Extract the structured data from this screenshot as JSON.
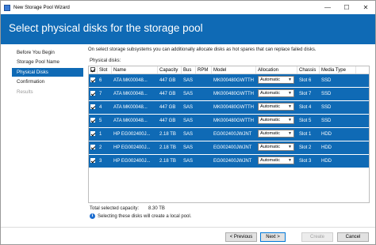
{
  "window": {
    "title": "New Storage Pool Wizard",
    "controls": {
      "minimize": "—",
      "maximize": "☐",
      "close": "✕"
    }
  },
  "header": {
    "title": "Select physical disks for the storage pool"
  },
  "nav": {
    "items": [
      {
        "label": "Before You Begin",
        "state": "normal"
      },
      {
        "label": "Storage Pool Name",
        "state": "normal"
      },
      {
        "label": "Physical Disks",
        "state": "active"
      },
      {
        "label": "Confirmation",
        "state": "normal"
      },
      {
        "label": "Results",
        "state": "disabled"
      }
    ]
  },
  "content": {
    "description": "On select storage subsystems you can additionally allocate disks as hot spares that can replace failed disks.",
    "physical_disks_label": "Physical disks:",
    "columns": [
      "",
      "Slot",
      "Name",
      "Capacity",
      "Bus",
      "RPM",
      "Model",
      "Allocation",
      "Chassis",
      "Media Type"
    ],
    "rows": [
      {
        "checked": true,
        "slot": "6",
        "name": "ATA MK00048...",
        "capacity": "447 GB",
        "bus": "SAS",
        "rpm": "",
        "model": "MK000480GWTTH",
        "allocation": "Automatic",
        "chassis": "Slot 6",
        "media": "SSD"
      },
      {
        "checked": true,
        "slot": "7",
        "name": "ATA MK00048...",
        "capacity": "447 GB",
        "bus": "SAS",
        "rpm": "",
        "model": "MK000480GWTTH",
        "allocation": "Automatic",
        "chassis": "Slot 7",
        "media": "SSD"
      },
      {
        "checked": true,
        "slot": "4",
        "name": "ATA MK00048...",
        "capacity": "447 GB",
        "bus": "SAS",
        "rpm": "",
        "model": "MK000480GWTTH",
        "allocation": "Automatic",
        "chassis": "Slot 4",
        "media": "SSD"
      },
      {
        "checked": true,
        "slot": "5",
        "name": "ATA MK00048...",
        "capacity": "447 GB",
        "bus": "SAS",
        "rpm": "",
        "model": "MK000480GWTTH",
        "allocation": "Automatic",
        "chassis": "Slot 5",
        "media": "SSD"
      },
      {
        "checked": true,
        "slot": "1",
        "name": "HP EG002400J...",
        "capacity": "2.18 TB",
        "bus": "SAS",
        "rpm": "",
        "model": "EG002400JWJNT",
        "allocation": "Automatic",
        "chassis": "Slot 1",
        "media": "HDD"
      },
      {
        "checked": true,
        "slot": "2",
        "name": "HP EG002400J...",
        "capacity": "2.18 TB",
        "bus": "SAS",
        "rpm": "",
        "model": "EG002400JWJNT",
        "allocation": "Automatic",
        "chassis": "Slot 2",
        "media": "HDD"
      },
      {
        "checked": true,
        "slot": "3",
        "name": "HP EG002400J...",
        "capacity": "2.18 TB",
        "bus": "SAS",
        "rpm": "",
        "model": "EG002400JWJNT",
        "allocation": "Automatic",
        "chassis": "Slot 3",
        "media": "HDD"
      }
    ],
    "total_label": "Total selected capacity:",
    "total_value": "8.30 TB",
    "info_text": "Selecting these disks will create a local pool."
  },
  "footer": {
    "previous": "< Previous",
    "next": "Next >",
    "create": "Create",
    "cancel": "Cancel"
  },
  "colors": {
    "accent": "#0f6ab5",
    "row_selected": "#0f6ab5"
  }
}
